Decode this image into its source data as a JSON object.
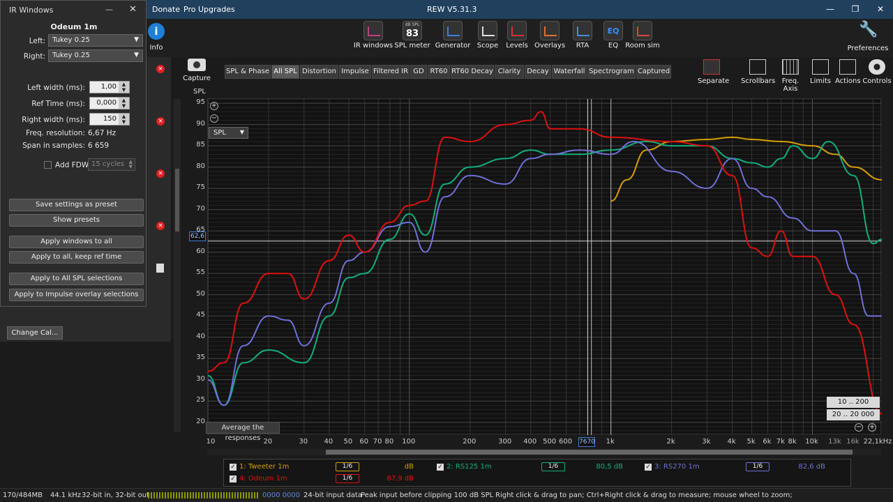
{
  "titlebar": {
    "menu_donate": "Donate",
    "menu_pro": "Pro Upgrades",
    "title": "REW V5.31.3"
  },
  "toolbar": [
    {
      "label": "IR windows",
      "icon": "ir-windows-icon"
    },
    {
      "label": "SPL meter",
      "icon": "spl-meter-icon",
      "badge_top": "dB SPL",
      "badge_value": "83"
    },
    {
      "label": "Generator",
      "icon": "generator-icon"
    },
    {
      "label": "Scope",
      "icon": "scope-icon"
    },
    {
      "label": "Levels",
      "icon": "levels-icon"
    },
    {
      "label": "Overlays",
      "icon": "overlays-icon"
    },
    {
      "label": "RTA",
      "icon": "rta-icon"
    },
    {
      "label": "EQ",
      "icon": "eq-icon",
      "badge_value": "EQ"
    },
    {
      "label": "Room sim",
      "icon": "room-sim-icon"
    }
  ],
  "info_label": "Info",
  "preferences_label": "Preferences",
  "capture_label": "Capture",
  "spl_axis_label": "SPL",
  "tabs": [
    "SPL & Phase",
    "All SPL",
    "Distortion",
    "Impulse",
    "Filtered IR",
    "GD",
    "RT60",
    "RT60 Decay",
    "Clarity",
    "Decay",
    "Waterfall",
    "Spectrogram",
    "Captured"
  ],
  "active_tab": "All SPL",
  "right_tools": [
    "Separate",
    "Scrollbars",
    "Freq. Axis",
    "Limits",
    "Actions",
    "Controls"
  ],
  "plot": {
    "selector": "SPL",
    "cursor_y_readout": "62,6",
    "cursor_x_readout": "7670",
    "average_button": "Average the responses",
    "range_buttons": [
      "10 .. 200",
      "20 .. 20 000"
    ],
    "y_ticks": [
      95,
      90,
      85,
      80,
      75,
      70,
      65,
      60,
      55,
      50,
      45,
      40,
      35,
      30,
      25,
      20
    ],
    "x_ticks": [
      "10",
      "20",
      "30",
      "40",
      "50",
      "60",
      "70",
      "80",
      "100",
      "200",
      "300",
      "400",
      "500",
      "600",
      "1k",
      "2k",
      "3k",
      "4k",
      "5k",
      "6k",
      "7k",
      "8k",
      "10k",
      "13k",
      "16k",
      "22,1kHz"
    ]
  },
  "chart_data": {
    "type": "line",
    "xscale": "log",
    "xlim": [
      10,
      22100
    ],
    "ylim": [
      17,
      96
    ],
    "ylabel": "SPL",
    "series": [
      {
        "name": "1: Tweeter 1m",
        "color": "#d8a000",
        "points": [
          [
            1000,
            72
          ],
          [
            1200,
            77
          ],
          [
            1500,
            84
          ],
          [
            2000,
            86
          ],
          [
            3000,
            86.5
          ],
          [
            4000,
            87
          ],
          [
            5000,
            86.5
          ],
          [
            7000,
            86
          ],
          [
            10000,
            85
          ],
          [
            13000,
            83
          ],
          [
            16000,
            80
          ],
          [
            22100,
            77
          ]
        ]
      },
      {
        "name": "2: RS125 1m",
        "color": "#10b080",
        "points": [
          [
            10,
            31
          ],
          [
            12,
            24
          ],
          [
            15,
            34
          ],
          [
            20,
            37
          ],
          [
            30,
            34
          ],
          [
            40,
            45
          ],
          [
            50,
            54
          ],
          [
            60,
            55
          ],
          [
            80,
            63
          ],
          [
            100,
            69
          ],
          [
            120,
            64
          ],
          [
            150,
            76
          ],
          [
            200,
            80
          ],
          [
            300,
            82
          ],
          [
            400,
            84
          ],
          [
            500,
            83
          ],
          [
            700,
            83
          ],
          [
            1000,
            84
          ],
          [
            1500,
            86
          ],
          [
            2000,
            85
          ],
          [
            3000,
            85
          ],
          [
            4000,
            82
          ],
          [
            5000,
            81
          ],
          [
            6000,
            80
          ],
          [
            7000,
            82
          ],
          [
            8000,
            85
          ],
          [
            10000,
            82
          ],
          [
            12000,
            86
          ],
          [
            16000,
            78
          ],
          [
            20000,
            62
          ],
          [
            22100,
            63
          ]
        ]
      },
      {
        "name": "3: RS270 1m",
        "color": "#7070d8",
        "points": [
          [
            10,
            30
          ],
          [
            12,
            24
          ],
          [
            15,
            38
          ],
          [
            20,
            45
          ],
          [
            25,
            44
          ],
          [
            30,
            38
          ],
          [
            40,
            48
          ],
          [
            50,
            58
          ],
          [
            60,
            60
          ],
          [
            80,
            66
          ],
          [
            100,
            67
          ],
          [
            120,
            60
          ],
          [
            150,
            73
          ],
          [
            200,
            78
          ],
          [
            300,
            76
          ],
          [
            400,
            82
          ],
          [
            500,
            83
          ],
          [
            700,
            84
          ],
          [
            1000,
            83
          ],
          [
            1300,
            86
          ],
          [
            2000,
            79
          ],
          [
            3000,
            75
          ],
          [
            4000,
            82
          ],
          [
            5000,
            75
          ],
          [
            6000,
            73
          ],
          [
            8000,
            68
          ],
          [
            10000,
            65
          ],
          [
            13000,
            65
          ],
          [
            16000,
            55
          ],
          [
            19000,
            45
          ],
          [
            22100,
            45
          ]
        ]
      },
      {
        "name": "4: Odeum 1m",
        "color": "#e01010",
        "points": [
          [
            10,
            32
          ],
          [
            12,
            34
          ],
          [
            15,
            48
          ],
          [
            20,
            55
          ],
          [
            25,
            55
          ],
          [
            30,
            49
          ],
          [
            40,
            58
          ],
          [
            50,
            64
          ],
          [
            60,
            60
          ],
          [
            80,
            67
          ],
          [
            100,
            71
          ],
          [
            120,
            72
          ],
          [
            150,
            87
          ],
          [
            200,
            86
          ],
          [
            300,
            90
          ],
          [
            400,
            91
          ],
          [
            450,
            93
          ],
          [
            500,
            89
          ],
          [
            700,
            89
          ],
          [
            1000,
            87
          ],
          [
            2000,
            86
          ],
          [
            3000,
            85
          ],
          [
            4000,
            78
          ],
          [
            5000,
            61
          ],
          [
            6000,
            59
          ],
          [
            7000,
            65
          ],
          [
            8000,
            59
          ],
          [
            10000,
            59
          ],
          [
            13000,
            50
          ],
          [
            16000,
            43
          ],
          [
            22100,
            22
          ]
        ]
      }
    ]
  },
  "left_dialog": {
    "title": "IR Windows",
    "subtitle": "Odeum 1m",
    "left_label": "Left:",
    "left_value": "Tukey 0.25",
    "right_label": "Right:",
    "right_value": "Tukey 0.25",
    "left_width_label": "Left width (ms):",
    "left_width_value": "1,00",
    "ref_time_label": "Ref Time (ms):",
    "ref_time_value": "0,000",
    "right_width_label": "Right width (ms):",
    "right_width_value": "150",
    "freq_res_label": "Freq. resolution:",
    "freq_res_value": "6,67 Hz",
    "span_label": "Span in samples:",
    "span_value": "6 659",
    "fdw_label": "Add FDW",
    "fdw_value": "15 cycles",
    "buttons": [
      "Save settings as preset",
      "Show presets",
      "Apply windows to all",
      "Apply to all, keep ref time",
      "Apply to All SPL selections",
      "Apply to Impulse overlay selections"
    ]
  },
  "change_cal_label": "Change Cal...",
  "legend": [
    {
      "label": "1: Tweeter 1m",
      "color": "#d8a000",
      "smoothing": "1/6",
      "value": "dB"
    },
    {
      "label": "2: RS125 1m",
      "color": "#10b080",
      "smoothing": "1/6",
      "value": "80,5 dB"
    },
    {
      "label": "3: RS270 1m",
      "color": "#7070d8",
      "smoothing": "1/6",
      "value": "82,6 dB"
    },
    {
      "label": "4: Odeum 1m",
      "color": "#e01010",
      "smoothing": "1/6",
      "value": "87,9 dB"
    }
  ],
  "status": {
    "memory": "170/484MB",
    "rate": "44.1 kHz",
    "bits": "32-bit in, 32-bit out",
    "meters": "0000 0000",
    "input_data": "24-bit input data",
    "peak": "Peak input before clipping 100 dB SPL",
    "hint": "Right click & drag to pan; Ctrl+Right click & drag to measure; mouse wheel to zoom;"
  }
}
